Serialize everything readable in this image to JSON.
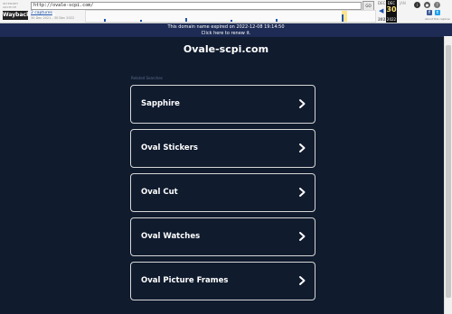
{
  "toolbar": {
    "logo_line1": "INTERNET ARCHIVE",
    "logo_line2": "WaybackMachine",
    "url": "http://ovale-scpi.com/",
    "go_label": "GO",
    "captures": "2 captures",
    "range": "30 Dec 2021 - 30 Dec 2022",
    "prev_month": "DEC",
    "prev_year": "2021",
    "cur_month": "DEC",
    "cur_day": "30",
    "cur_year": "2022",
    "next_month": "JAN",
    "about": "About this capture"
  },
  "banner": {
    "line1": "This domain name expired on 2022-12-08 19:14:50",
    "line2": "Click here to renew it."
  },
  "domain_title": "Ovale-scpi.com",
  "related_label": "Related Searches",
  "searches": [
    {
      "label": "Sapphire"
    },
    {
      "label": "Oval Stickers"
    },
    {
      "label": "Oval Cut"
    },
    {
      "label": "Oval Watches"
    },
    {
      "label": "Oval Picture Frames"
    }
  ],
  "colors": {
    "background": "#101b2e",
    "banner": "#1d2b55",
    "card_border": "#d6d6d6"
  }
}
